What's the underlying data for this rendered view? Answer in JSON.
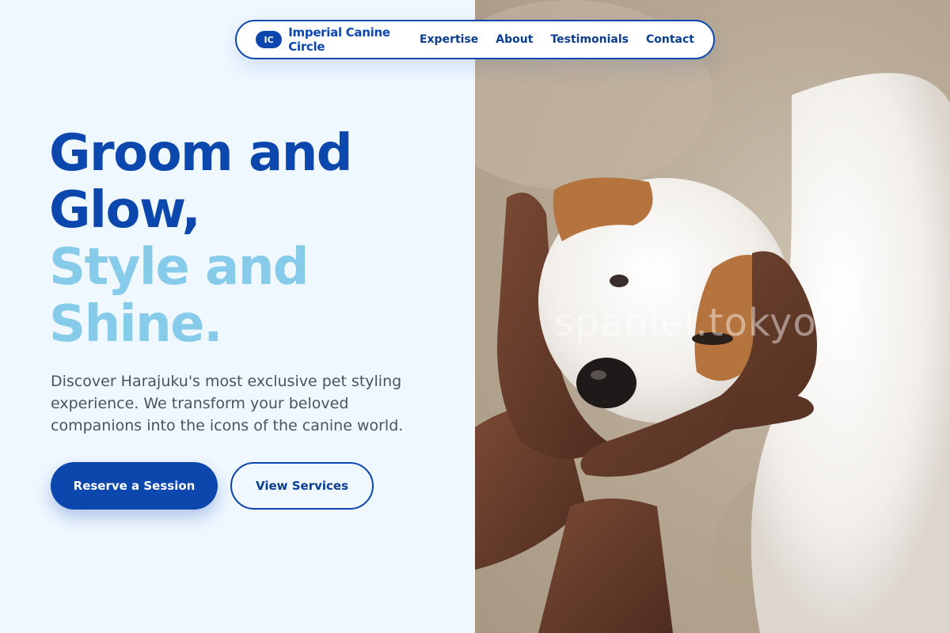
{
  "nav": {
    "logo_initials": "IC",
    "brand": "Imperial Canine Circle",
    "links": [
      "Expertise",
      "About",
      "Testimonials",
      "Contact"
    ]
  },
  "hero": {
    "title_dark": [
      "Groom and",
      "Glow,"
    ],
    "title_light": [
      "Style and",
      "Shine."
    ],
    "description": "Discover Harajuku's most exclusive pet styling experience. We transform your beloved companions into the icons of the canine world.",
    "primary_cta": "Reserve a Session",
    "secondary_cta": "View Services"
  },
  "image": {
    "watermark": "spaniel.tokyo",
    "subject": "white-puppy-held-in-hands"
  },
  "colors": {
    "primary": "#0b47ad",
    "accent_light": "#86cbea",
    "background": "#eff7ff",
    "text_muted": "#4a5360"
  }
}
